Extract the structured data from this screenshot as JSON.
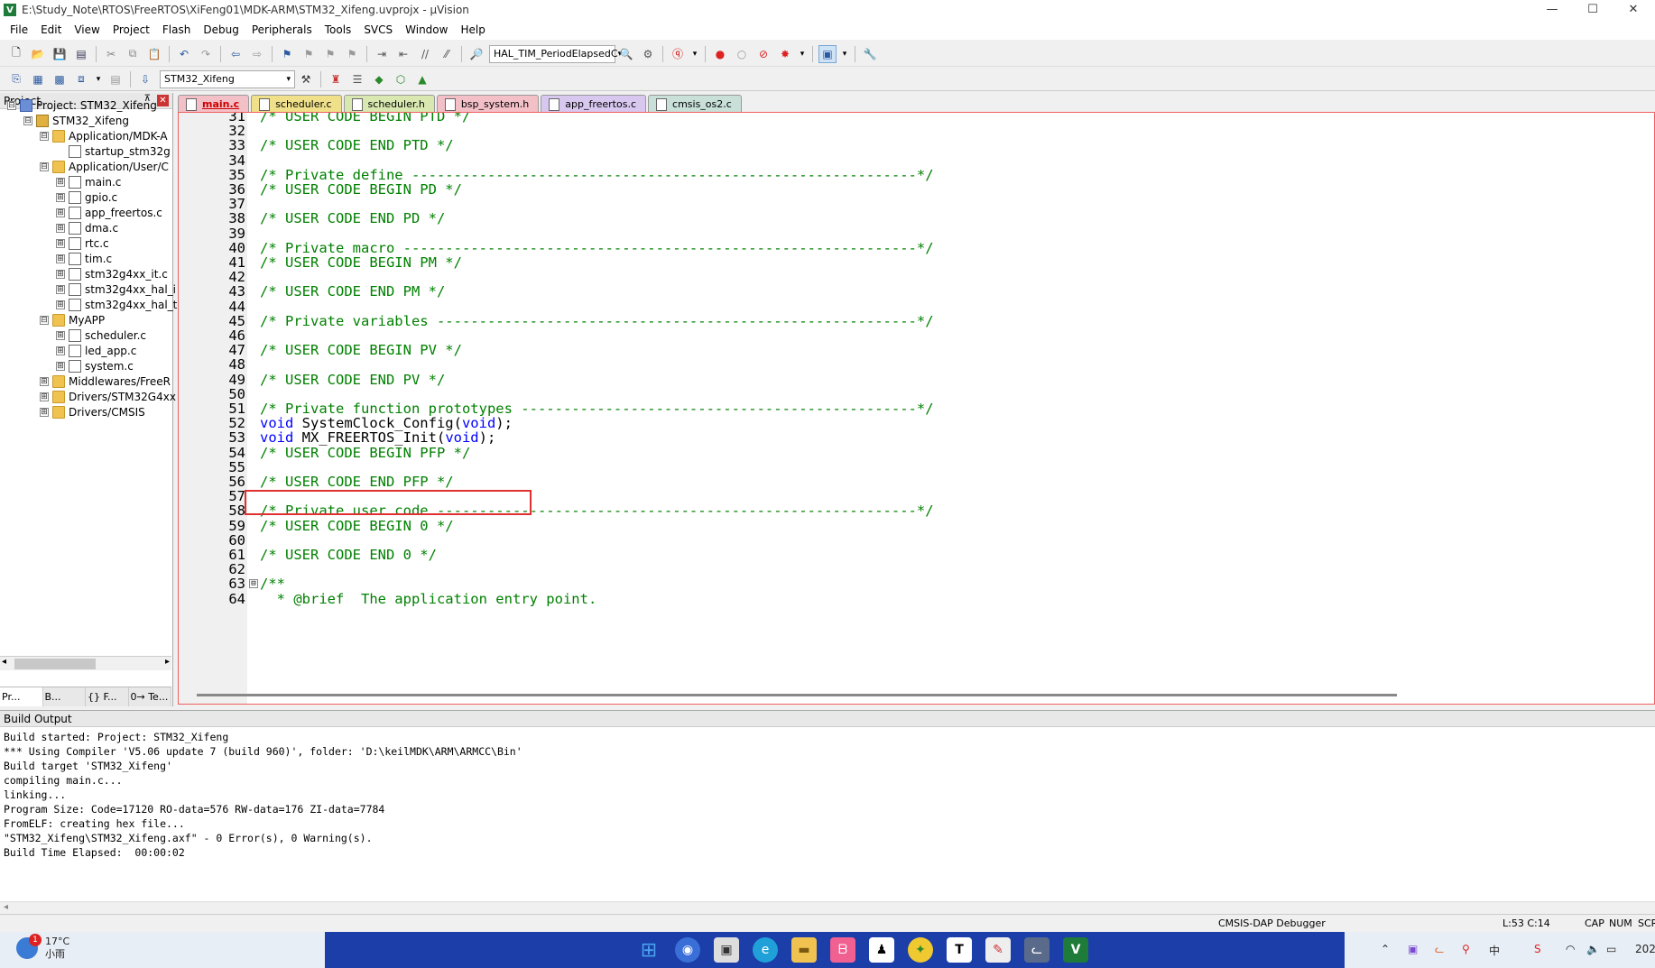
{
  "window": {
    "title": "E:\\Study_Note\\RTOS\\FreeRTOS\\XiFeng01\\MDK-ARM\\STM32_Xifeng.uvprojx - µVision",
    "minimize": "—",
    "maximize": "☐",
    "close": "✕"
  },
  "menu": [
    "File",
    "Edit",
    "View",
    "Project",
    "Flash",
    "Debug",
    "Peripherals",
    "Tools",
    "SVCS",
    "Window",
    "Help"
  ],
  "toolbar": {
    "find_combo": "HAL_TIM_PeriodElapsedC",
    "target_combo": "STM32_Xifeng"
  },
  "project": {
    "header": "Project",
    "pin": "⊼",
    "close": "✕",
    "tree": [
      {
        "label": "Project: STM32_Xifeng",
        "level": 0,
        "icon": "proj",
        "exp": "⊟"
      },
      {
        "label": "STM32_Xifeng",
        "level": 1,
        "icon": "target",
        "exp": "⊟"
      },
      {
        "label": "Application/MDK-A",
        "level": 2,
        "icon": "folder",
        "exp": "⊟"
      },
      {
        "label": "startup_stm32g",
        "level": 3,
        "icon": "file",
        "exp": ""
      },
      {
        "label": "Application/User/C",
        "level": 2,
        "icon": "folder",
        "exp": "⊟"
      },
      {
        "label": "main.c",
        "level": 3,
        "icon": "file",
        "exp": "⊞"
      },
      {
        "label": "gpio.c",
        "level": 3,
        "icon": "file",
        "exp": "⊞"
      },
      {
        "label": "app_freertos.c",
        "level": 3,
        "icon": "file",
        "exp": "⊞"
      },
      {
        "label": "dma.c",
        "level": 3,
        "icon": "file",
        "exp": "⊞"
      },
      {
        "label": "rtc.c",
        "level": 3,
        "icon": "file",
        "exp": "⊞"
      },
      {
        "label": "tim.c",
        "level": 3,
        "icon": "file",
        "exp": "⊞"
      },
      {
        "label": "stm32g4xx_it.c",
        "level": 3,
        "icon": "file",
        "exp": "⊞"
      },
      {
        "label": "stm32g4xx_hal_i",
        "level": 3,
        "icon": "file",
        "exp": "⊞"
      },
      {
        "label": "stm32g4xx_hal_t",
        "level": 3,
        "icon": "file",
        "exp": "⊞"
      },
      {
        "label": "MyAPP",
        "level": 2,
        "icon": "folder",
        "exp": "⊟"
      },
      {
        "label": "scheduler.c",
        "level": 3,
        "icon": "file",
        "exp": "⊞"
      },
      {
        "label": "led_app.c",
        "level": 3,
        "icon": "file",
        "exp": "⊞"
      },
      {
        "label": "system.c",
        "level": 3,
        "icon": "file",
        "exp": "⊞"
      },
      {
        "label": "Middlewares/FreeR",
        "level": 2,
        "icon": "folder",
        "exp": "⊞"
      },
      {
        "label": "Drivers/STM32G4xx",
        "level": 2,
        "icon": "folder",
        "exp": "⊞"
      },
      {
        "label": "Drivers/CMSIS",
        "level": 2,
        "icon": "folder",
        "exp": "⊞"
      }
    ],
    "bottom_tabs": [
      "Pr...",
      "B...",
      "{} F...",
      "0→ Te..."
    ]
  },
  "editor_tabs": [
    {
      "label": "main.c",
      "color": "#f4c0c8",
      "active": true
    },
    {
      "label": "scheduler.c",
      "color": "#f0e08a",
      "active": false
    },
    {
      "label": "scheduler.h",
      "color": "#d8e8b0",
      "active": false
    },
    {
      "label": "bsp_system.h",
      "color": "#f4c0c8",
      "active": false
    },
    {
      "label": "app_freertos.c",
      "color": "#d8c8f0",
      "active": false
    },
    {
      "label": "cmsis_os2.c",
      "color": "#c8e0d8",
      "active": false
    }
  ],
  "code": [
    {
      "n": "31",
      "segs": [
        {
          "t": "/* USER CODE BEGIN PTD */",
          "c": "cm"
        }
      ]
    },
    {
      "n": "32",
      "segs": []
    },
    {
      "n": "33",
      "segs": [
        {
          "t": "/* USER CODE END PTD */",
          "c": "cm"
        }
      ]
    },
    {
      "n": "34",
      "segs": []
    },
    {
      "n": "35",
      "segs": [
        {
          "t": "/* Private define ------------------------------------------------------------*/",
          "c": "cm"
        }
      ]
    },
    {
      "n": "36",
      "segs": [
        {
          "t": "/* USER CODE BEGIN PD */",
          "c": "cm"
        }
      ]
    },
    {
      "n": "37",
      "segs": []
    },
    {
      "n": "38",
      "segs": [
        {
          "t": "/* USER CODE END PD */",
          "c": "cm"
        }
      ]
    },
    {
      "n": "39",
      "segs": []
    },
    {
      "n": "40",
      "segs": [
        {
          "t": "/* Private macro -------------------------------------------------------------*/",
          "c": "cm"
        }
      ]
    },
    {
      "n": "41",
      "segs": [
        {
          "t": "/* USER CODE BEGIN PM */",
          "c": "cm"
        }
      ]
    },
    {
      "n": "42",
      "segs": []
    },
    {
      "n": "43",
      "segs": [
        {
          "t": "/* USER CODE END PM */",
          "c": "cm"
        }
      ]
    },
    {
      "n": "44",
      "segs": []
    },
    {
      "n": "45",
      "segs": [
        {
          "t": "/* Private variables ---------------------------------------------------------*/",
          "c": "cm"
        }
      ]
    },
    {
      "n": "46",
      "segs": []
    },
    {
      "n": "47",
      "segs": [
        {
          "t": "/* USER CODE BEGIN PV */",
          "c": "cm"
        }
      ]
    },
    {
      "n": "48",
      "segs": []
    },
    {
      "n": "49",
      "segs": [
        {
          "t": "/* USER CODE END PV */",
          "c": "cm"
        }
      ]
    },
    {
      "n": "50",
      "segs": []
    },
    {
      "n": "51",
      "segs": [
        {
          "t": "/* Private function prototypes -----------------------------------------------*/",
          "c": "cm"
        }
      ]
    },
    {
      "n": "52",
      "segs": [
        {
          "t": "void",
          "c": "kw"
        },
        {
          "t": " SystemClock_Config(",
          "c": "fn"
        },
        {
          "t": "void",
          "c": "kw"
        },
        {
          "t": ");",
          "c": "fn"
        }
      ]
    },
    {
      "n": "53",
      "segs": [
        {
          "t": "void",
          "c": "kw"
        },
        {
          "t": " MX_FREERTOS_Init(",
          "c": "fn"
        },
        {
          "t": "void",
          "c": "kw"
        },
        {
          "t": ");",
          "c": "fn"
        }
      ]
    },
    {
      "n": "54",
      "segs": [
        {
          "t": "/* USER CODE BEGIN PFP */",
          "c": "cm"
        }
      ]
    },
    {
      "n": "55",
      "segs": []
    },
    {
      "n": "56",
      "segs": [
        {
          "t": "/* USER CODE END PFP */",
          "c": "cm"
        }
      ]
    },
    {
      "n": "57",
      "segs": []
    },
    {
      "n": "58",
      "segs": [
        {
          "t": "/* Private user code ---------------------------------------------------------*/",
          "c": "cm"
        }
      ]
    },
    {
      "n": "59",
      "segs": [
        {
          "t": "/* USER CODE BEGIN 0 */",
          "c": "cm"
        }
      ]
    },
    {
      "n": "60",
      "segs": []
    },
    {
      "n": "61",
      "segs": [
        {
          "t": "/* USER CODE END 0 */",
          "c": "cm"
        }
      ]
    },
    {
      "n": "62",
      "segs": []
    },
    {
      "n": "63",
      "segs": [
        {
          "t": "/**",
          "c": "cm"
        }
      ]
    },
    {
      "n": "64",
      "segs": [
        {
          "t": "  * @brief  The application entry point.",
          "c": "cm"
        }
      ]
    }
  ],
  "fold_marker": "⊟",
  "build_output": {
    "header": "Build Output",
    "lines": [
      "Build started: Project: STM32_Xifeng",
      "*** Using Compiler 'V5.06 update 7 (build 960)', folder: 'D:\\keilMDK\\ARM\\ARMCC\\Bin'",
      "Build target 'STM32_Xifeng'",
      "compiling main.c...",
      "linking...",
      "Program Size: Code=17120 RO-data=576 RW-data=176 ZI-data=7784",
      "FromELF: creating hex file...",
      "\"STM32_Xifeng\\STM32_Xifeng.axf\" - 0 Error(s), 0 Warning(s).",
      "Build Time Elapsed:  00:00:02"
    ]
  },
  "status": {
    "debugger": "CMSIS-DAP Debugger",
    "position": "L:53 C:14",
    "cap": "CAP",
    "num": "NUM",
    "scrl": "SCRL"
  },
  "taskbar": {
    "badge": "1",
    "temp": "17°C",
    "weather": "小雨",
    "year": "202"
  }
}
